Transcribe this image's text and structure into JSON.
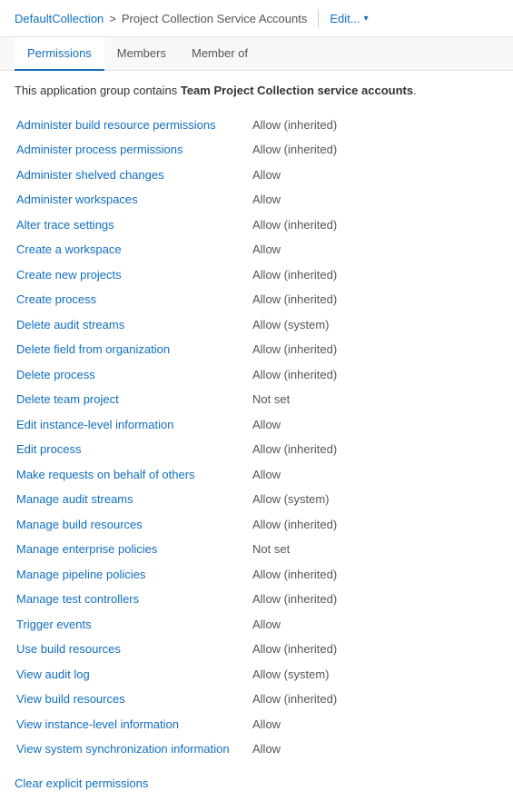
{
  "header": {
    "collection_link": "DefaultCollection",
    "separator": ">",
    "current_page": "Project Collection Service Accounts",
    "edit_label": "Edit...",
    "chevron": "▾"
  },
  "tabs": [
    {
      "id": "permissions",
      "label": "Permissions",
      "active": true
    },
    {
      "id": "members",
      "label": "Members",
      "active": false
    },
    {
      "id": "member-of",
      "label": "Member of",
      "active": false
    }
  ],
  "description": {
    "prefix": "This application group contains ",
    "highlight": "Team Project Collection service accounts",
    "suffix": "."
  },
  "permissions": [
    {
      "name": "Administer build resource permissions",
      "value": "Allow (inherited)"
    },
    {
      "name": "Administer process permissions",
      "value": "Allow (inherited)"
    },
    {
      "name": "Administer shelved changes",
      "value": "Allow"
    },
    {
      "name": "Administer workspaces",
      "value": "Allow"
    },
    {
      "name": "Alter trace settings",
      "value": "Allow (inherited)"
    },
    {
      "name": "Create a workspace",
      "value": "Allow"
    },
    {
      "name": "Create new projects",
      "value": "Allow (inherited)"
    },
    {
      "name": "Create process",
      "value": "Allow (inherited)"
    },
    {
      "name": "Delete audit streams",
      "value": "Allow (system)"
    },
    {
      "name": "Delete field from organization",
      "value": "Allow (inherited)"
    },
    {
      "name": "Delete process",
      "value": "Allow (inherited)"
    },
    {
      "name": "Delete team project",
      "value": "Not set"
    },
    {
      "name": "Edit instance-level information",
      "value": "Allow"
    },
    {
      "name": "Edit process",
      "value": "Allow (inherited)"
    },
    {
      "name": "Make requests on behalf of others",
      "value": "Allow"
    },
    {
      "name": "Manage audit streams",
      "value": "Allow (system)"
    },
    {
      "name": "Manage build resources",
      "value": "Allow (inherited)"
    },
    {
      "name": "Manage enterprise policies",
      "value": "Not set"
    },
    {
      "name": "Manage pipeline policies",
      "value": "Allow (inherited)"
    },
    {
      "name": "Manage test controllers",
      "value": "Allow (inherited)"
    },
    {
      "name": "Trigger events",
      "value": "Allow"
    },
    {
      "name": "Use build resources",
      "value": "Allow (inherited)"
    },
    {
      "name": "View audit log",
      "value": "Allow (system)"
    },
    {
      "name": "View build resources",
      "value": "Allow (inherited)"
    },
    {
      "name": "View instance-level information",
      "value": "Allow"
    },
    {
      "name": "View system synchronization information",
      "value": "Allow"
    }
  ],
  "clear_link_label": "Clear explicit permissions"
}
